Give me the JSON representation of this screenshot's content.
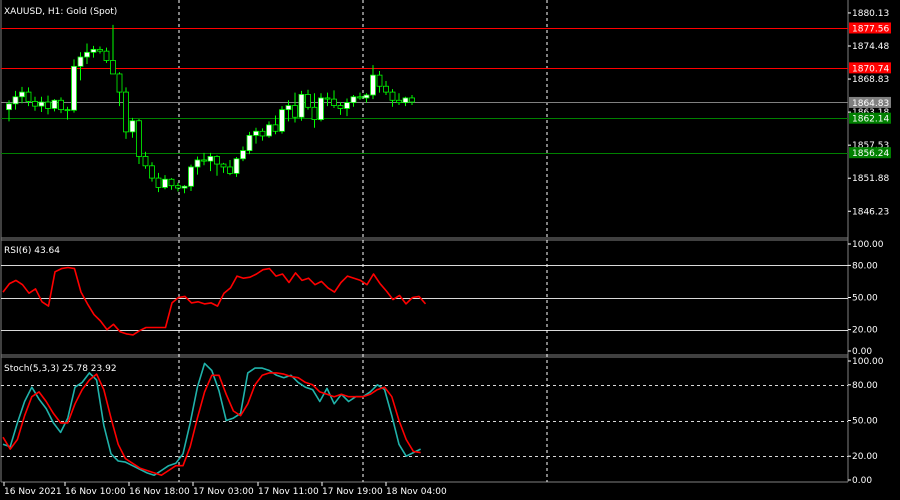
{
  "chart_data": [
    {
      "type": "candlestick",
      "title": "XAUUSD, H1:  Gold (Spot)",
      "ylim": [
        1842,
        1882
      ],
      "yticks": [
        "1880.13",
        "1874.48",
        "1868.83",
        "1863.18",
        "1857.53",
        "1851.88",
        "1846.23"
      ],
      "price_labels": [
        {
          "text": "1877.56",
          "value": 1877.56,
          "color": "#ff0000"
        },
        {
          "text": "1870.74",
          "value": 1870.74,
          "color": "#ff0000"
        },
        {
          "text": "1864.83",
          "value": 1864.83,
          "color": "#808080"
        },
        {
          "text": "1862.14",
          "value": 1862.14,
          "color": "#008000"
        },
        {
          "text": "1856.24",
          "value": 1856.24,
          "color": "#008000"
        }
      ],
      "candles": [
        {
          "o": 1863.6,
          "h": 1865.2,
          "l": 1861.6,
          "c": 1864.6
        },
        {
          "o": 1864.6,
          "h": 1866.8,
          "l": 1863.6,
          "c": 1865.8
        },
        {
          "o": 1865.8,
          "h": 1867.5,
          "l": 1864.7,
          "c": 1866.6
        },
        {
          "o": 1866.6,
          "h": 1867.4,
          "l": 1864.2,
          "c": 1865.0
        },
        {
          "o": 1865.0,
          "h": 1865.8,
          "l": 1863.4,
          "c": 1864.2
        },
        {
          "o": 1864.2,
          "h": 1865.8,
          "l": 1863.2,
          "c": 1864.9
        },
        {
          "o": 1864.9,
          "h": 1866.0,
          "l": 1862.8,
          "c": 1863.8
        },
        {
          "o": 1863.8,
          "h": 1865.4,
          "l": 1863.3,
          "c": 1865.2
        },
        {
          "o": 1865.2,
          "h": 1865.7,
          "l": 1863.0,
          "c": 1863.6
        },
        {
          "o": 1863.6,
          "h": 1864.1,
          "l": 1861.9,
          "c": 1863.5
        },
        {
          "o": 1863.5,
          "h": 1872.2,
          "l": 1863.1,
          "c": 1871.0
        },
        {
          "o": 1871.0,
          "h": 1873.4,
          "l": 1868.6,
          "c": 1872.6
        },
        {
          "o": 1872.6,
          "h": 1874.9,
          "l": 1871.4,
          "c": 1873.4
        },
        {
          "o": 1873.4,
          "h": 1874.5,
          "l": 1872.5,
          "c": 1873.9
        },
        {
          "o": 1873.9,
          "h": 1874.4,
          "l": 1873.2,
          "c": 1873.6
        },
        {
          "o": 1873.6,
          "h": 1874.2,
          "l": 1871.6,
          "c": 1872.0
        },
        {
          "o": 1872.0,
          "h": 1878.1,
          "l": 1871.5,
          "c": 1869.7
        },
        {
          "o": 1869.7,
          "h": 1870.0,
          "l": 1864.2,
          "c": 1866.6
        },
        {
          "o": 1866.6,
          "h": 1867.4,
          "l": 1858.6,
          "c": 1859.8
        },
        {
          "o": 1859.8,
          "h": 1862.2,
          "l": 1858.8,
          "c": 1861.7
        },
        {
          "o": 1861.7,
          "h": 1862.0,
          "l": 1854.3,
          "c": 1855.6
        },
        {
          "o": 1855.6,
          "h": 1856.4,
          "l": 1853.5,
          "c": 1854.0
        },
        {
          "o": 1854.0,
          "h": 1854.6,
          "l": 1851.3,
          "c": 1851.9
        },
        {
          "o": 1851.9,
          "h": 1852.8,
          "l": 1849.5,
          "c": 1850.3
        },
        {
          "o": 1850.3,
          "h": 1852.4,
          "l": 1850.0,
          "c": 1851.7
        },
        {
          "o": 1851.7,
          "h": 1851.9,
          "l": 1849.9,
          "c": 1850.6
        },
        {
          "o": 1850.6,
          "h": 1851.1,
          "l": 1849.6,
          "c": 1850.2
        },
        {
          "o": 1850.2,
          "h": 1850.7,
          "l": 1849.3,
          "c": 1850.5
        },
        {
          "o": 1850.5,
          "h": 1854.2,
          "l": 1849.7,
          "c": 1853.8
        },
        {
          "o": 1853.8,
          "h": 1855.6,
          "l": 1852.5,
          "c": 1855.0
        },
        {
          "o": 1855.0,
          "h": 1856.2,
          "l": 1854.1,
          "c": 1854.8
        },
        {
          "o": 1854.8,
          "h": 1856.2,
          "l": 1853.1,
          "c": 1855.6
        },
        {
          "o": 1855.6,
          "h": 1855.8,
          "l": 1852.3,
          "c": 1854.3
        },
        {
          "o": 1854.3,
          "h": 1854.5,
          "l": 1852.8,
          "c": 1853.8
        },
        {
          "o": 1853.8,
          "h": 1855.0,
          "l": 1852.4,
          "c": 1852.7
        },
        {
          "o": 1852.7,
          "h": 1855.5,
          "l": 1852.1,
          "c": 1855.2
        },
        {
          "o": 1855.2,
          "h": 1857.3,
          "l": 1854.8,
          "c": 1856.6
        },
        {
          "o": 1856.6,
          "h": 1859.8,
          "l": 1856.0,
          "c": 1859.2
        },
        {
          "o": 1859.2,
          "h": 1860.5,
          "l": 1857.8,
          "c": 1859.9
        },
        {
          "o": 1859.9,
          "h": 1860.4,
          "l": 1858.3,
          "c": 1859.1
        },
        {
          "o": 1859.1,
          "h": 1861.6,
          "l": 1858.8,
          "c": 1861.0
        },
        {
          "o": 1861.0,
          "h": 1862.6,
          "l": 1859.4,
          "c": 1859.9
        },
        {
          "o": 1859.9,
          "h": 1864.2,
          "l": 1859.5,
          "c": 1863.6
        },
        {
          "o": 1863.6,
          "h": 1865.2,
          "l": 1861.6,
          "c": 1864.3
        },
        {
          "o": 1864.3,
          "h": 1866.5,
          "l": 1861.4,
          "c": 1862.3
        },
        {
          "o": 1862.3,
          "h": 1866.8,
          "l": 1861.7,
          "c": 1866.2
        },
        {
          "o": 1866.2,
          "h": 1867.0,
          "l": 1863.6,
          "c": 1864.0
        },
        {
          "o": 1864.0,
          "h": 1866.4,
          "l": 1860.5,
          "c": 1861.9
        },
        {
          "o": 1861.9,
          "h": 1866.4,
          "l": 1861.6,
          "c": 1865.6
        },
        {
          "o": 1865.6,
          "h": 1866.5,
          "l": 1864.2,
          "c": 1865.4
        },
        {
          "o": 1865.4,
          "h": 1866.9,
          "l": 1863.9,
          "c": 1864.3
        },
        {
          "o": 1864.3,
          "h": 1864.9,
          "l": 1862.7,
          "c": 1863.8
        },
        {
          "o": 1863.8,
          "h": 1865.5,
          "l": 1862.5,
          "c": 1864.8
        },
        {
          "o": 1864.8,
          "h": 1866.1,
          "l": 1864.1,
          "c": 1865.8
        },
        {
          "o": 1865.8,
          "h": 1866.5,
          "l": 1865.3,
          "c": 1865.6
        },
        {
          "o": 1865.6,
          "h": 1866.4,
          "l": 1864.8,
          "c": 1866.1
        },
        {
          "o": 1866.1,
          "h": 1871.2,
          "l": 1865.4,
          "c": 1869.5
        },
        {
          "o": 1869.5,
          "h": 1870.2,
          "l": 1866.5,
          "c": 1867.6
        },
        {
          "o": 1867.6,
          "h": 1868.5,
          "l": 1866.1,
          "c": 1866.6
        },
        {
          "o": 1866.6,
          "h": 1867.1,
          "l": 1864.1,
          "c": 1865.2
        },
        {
          "o": 1865.2,
          "h": 1866.4,
          "l": 1864.4,
          "c": 1864.8
        },
        {
          "o": 1864.8,
          "h": 1865.8,
          "l": 1864.2,
          "c": 1865.6
        },
        {
          "o": 1865.6,
          "h": 1866.1,
          "l": 1864.4,
          "c": 1864.9
        }
      ],
      "bull_color": "#ffffff",
      "bear_color": "#000000",
      "candle_outline": "#00ff00"
    },
    {
      "type": "line",
      "title": "RSI(6) 43.64",
      "ylim": [
        0,
        100
      ],
      "yticks": [
        "100.00",
        "80.00",
        "50.00",
        "20.00",
        "0.00"
      ],
      "levels": [
        80,
        50,
        20
      ],
      "series": [
        {
          "color": "#ff0000",
          "values": [
            55,
            63,
            66,
            62,
            54,
            58,
            46,
            42,
            74,
            77,
            78,
            77,
            55,
            44,
            34,
            28,
            20,
            25,
            18,
            16,
            15,
            19,
            22,
            22,
            22,
            22,
            45,
            50,
            51,
            45,
            46,
            44,
            45,
            42,
            54,
            59,
            70,
            68,
            69,
            72,
            76,
            77,
            70,
            72,
            64,
            73,
            66,
            68,
            62,
            65,
            59,
            55,
            64,
            70,
            68,
            66,
            62,
            72,
            63,
            56,
            48,
            52,
            44,
            50,
            51,
            44
          ]
        }
      ]
    },
    {
      "type": "line",
      "title": "Stoch(5,3,3) 25.78 23.92",
      "ylim": [
        0,
        100
      ],
      "yticks": [
        "100.00",
        "80.00",
        "50.00",
        "20.00",
        "0.00"
      ],
      "levels": [
        80,
        50,
        20
      ],
      "series": [
        {
          "color": "#20b2aa",
          "values": [
            30,
            28,
            48,
            66,
            78,
            68,
            60,
            48,
            40,
            52,
            78,
            82,
            90,
            84,
            46,
            22,
            16,
            15,
            12,
            9,
            6,
            4,
            8,
            12,
            14,
            22,
            48,
            78,
            98,
            92,
            75,
            50,
            52,
            56,
            90,
            94,
            94,
            92,
            88,
            86,
            88,
            82,
            78,
            76,
            66,
            77,
            64,
            72,
            66,
            70,
            70,
            74,
            80,
            76,
            54,
            30,
            20,
            23,
            26
          ]
        },
        {
          "color": "#ff0000",
          "values": [
            36,
            26,
            34,
            54,
            70,
            74,
            66,
            56,
            48,
            48,
            64,
            76,
            84,
            89,
            76,
            52,
            30,
            18,
            14,
            10,
            8,
            6,
            4,
            8,
            12,
            12,
            28,
            52,
            74,
            88,
            88,
            72,
            58,
            54,
            64,
            80,
            88,
            90,
            90,
            89,
            87,
            86,
            82,
            80,
            74,
            72,
            70,
            72,
            70,
            70,
            70,
            72,
            76,
            78,
            70,
            50,
            34,
            24,
            23
          ]
        }
      ]
    },
    {
      "type": "time_axis",
      "labels": [
        "16 Nov 2021",
        "16 Nov 10:00",
        "16 Nov 18:00",
        "17 Nov 03:00",
        "17 Nov 11:00",
        "17 Nov 19:00",
        "18 Nov 04:00"
      ]
    }
  ],
  "colors": {
    "background": "#000000",
    "grid": "#ffffff",
    "text": "#ffffff",
    "separator": "#808080"
  }
}
